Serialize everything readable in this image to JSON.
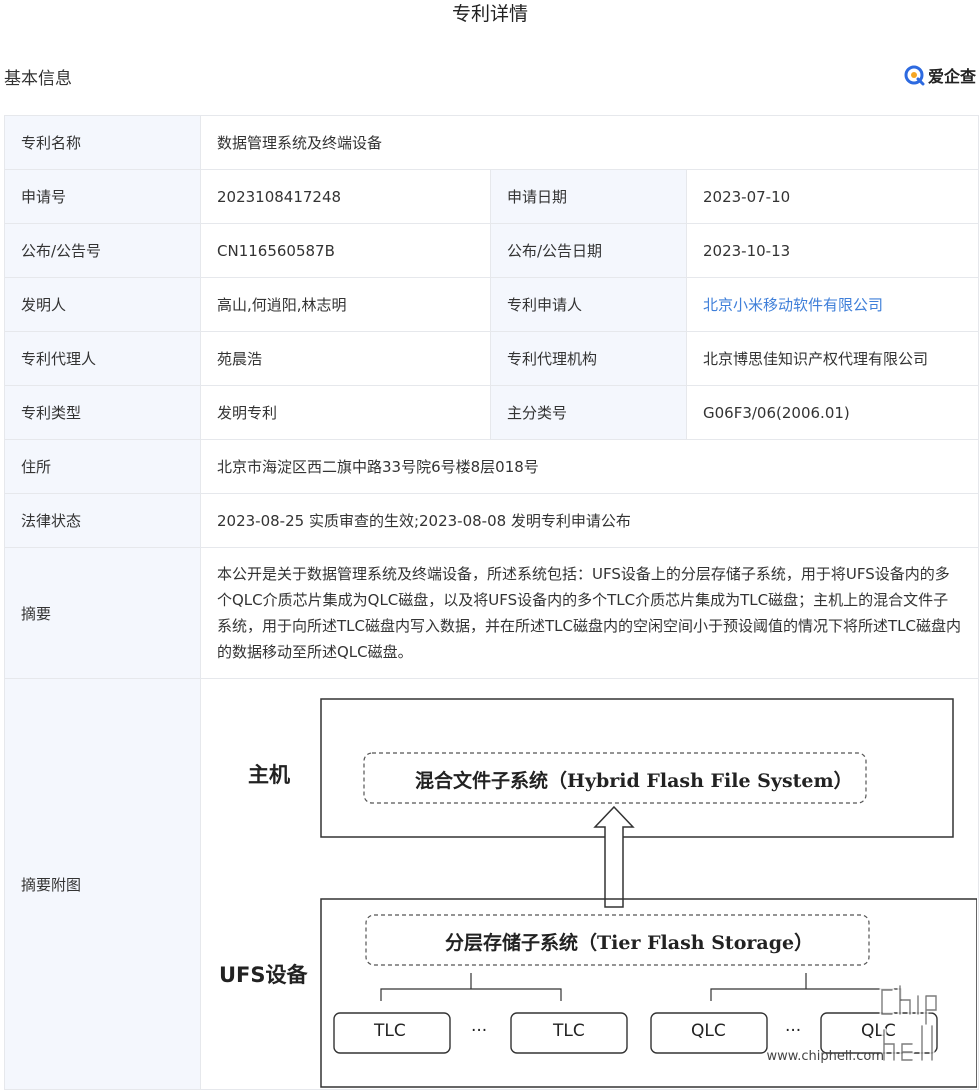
{
  "page": {
    "title": "专利详情"
  },
  "section": {
    "title": "基本信息",
    "brand": "爱企查"
  },
  "rows": {
    "name": {
      "label": "专利名称",
      "value": "数据管理系统及终端设备"
    },
    "app_no": {
      "label": "申请号",
      "value": "2023108417248",
      "label2": "申请日期",
      "value2": "2023-07-10"
    },
    "pub_no": {
      "label": "公布/公告号",
      "value": "CN116560587B",
      "label2": "公布/公告日期",
      "value2": "2023-10-13"
    },
    "inventor": {
      "label": "发明人",
      "value": "高山,何逍阳,林志明",
      "label2": "专利申请人",
      "value2": "北京小米移动软件有限公司"
    },
    "agent": {
      "label": "专利代理人",
      "value": "苑晨浩",
      "label2": "专利代理机构",
      "value2": "北京博思佳知识产权代理有限公司"
    },
    "type": {
      "label": "专利类型",
      "value": "发明专利",
      "label2": "主分类号",
      "value2": "G06F3/06(2006.01)"
    },
    "address": {
      "label": "住所",
      "value": "北京市海淀区西二旗中路33号院6号楼8层018号"
    },
    "legal": {
      "label": "法律状态",
      "value": "2023-08-25 实质审查的生效;2023-08-08 发明专利申请公布"
    },
    "abstract": {
      "label": "摘要",
      "value": "本公开是关于数据管理系统及终端设备，所述系统包括：UFS设备上的分层存储子系统，用于将UFS设备内的多个QLC介质芯片集成为QLC磁盘，以及将UFS设备内的多个TLC介质芯片集成为TLC磁盘；主机上的混合文件子系统，用于向所述TLC磁盘内写入数据，并在所述TLC磁盘内的空闲空间小于预设阈值的情况下将所述TLC磁盘内的数据移动至所述QLC磁盘。"
    },
    "figure": {
      "label": "摘要附图"
    }
  },
  "diagram": {
    "host_label": "主机",
    "host_box": "混合文件子系统（Hybrid Flash File System）",
    "ufs_label": "UFS设备",
    "ufs_box": "分层存储子系统（Tier Flash Storage）",
    "chips": [
      "TLC",
      "TLC",
      "QLC",
      "QLC"
    ],
    "ellipsis": "···"
  },
  "watermark": {
    "text": "chip hell",
    "url": "www.chiphell.com"
  }
}
